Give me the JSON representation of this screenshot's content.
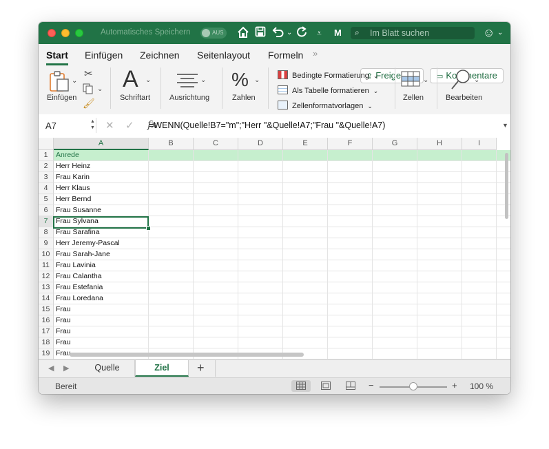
{
  "titlebar": {
    "autosave_label": "Automatisches Speichern",
    "autosave_toggle": "AUS",
    "search_placeholder": "Im Blatt suchen",
    "profile_initial": "M"
  },
  "ribbon": {
    "tabs": [
      "Start",
      "Einfügen",
      "Zeichnen",
      "Seitenlayout",
      "Formeln"
    ],
    "share_label": "Freigeben",
    "comments_label": "Kommentare",
    "groups": {
      "paste": "Einfügen",
      "font": "Schriftart",
      "alignment": "Ausrichtung",
      "number": "Zahlen",
      "cells": "Zellen",
      "edit": "Bearbeiten"
    },
    "styles": {
      "conditional": "Bedingte Formatierung",
      "as_table": "Als Tabelle formatieren",
      "cell_styles": "Zellenformatvorlagen"
    }
  },
  "formula_bar": {
    "name_box": "A7",
    "fx": "fx",
    "formula": "=WENN(Quelle!B7=\"m\";\"Herr \"&Quelle!A7;\"Frau \"&Quelle!A7)"
  },
  "sheet": {
    "columns": [
      "A",
      "B",
      "C",
      "D",
      "E",
      "F",
      "G",
      "H",
      "I"
    ],
    "selected_cell": "A7",
    "rows": [
      {
        "n": "1",
        "a": "Anrede"
      },
      {
        "n": "2",
        "a": "Herr Heinz"
      },
      {
        "n": "3",
        "a": "Frau Karin"
      },
      {
        "n": "4",
        "a": "Herr Klaus"
      },
      {
        "n": "5",
        "a": "Herr Bernd"
      },
      {
        "n": "6",
        "a": "Frau Susanne"
      },
      {
        "n": "7",
        "a": "Frau Sylvana"
      },
      {
        "n": "8",
        "a": "Frau Sarafina"
      },
      {
        "n": "9",
        "a": "Herr Jeremy-Pascal"
      },
      {
        "n": "10",
        "a": "Frau Sarah-Jane"
      },
      {
        "n": "11",
        "a": "Frau Lavinia"
      },
      {
        "n": "12",
        "a": "Frau Calantha"
      },
      {
        "n": "13",
        "a": "Frau Estefania"
      },
      {
        "n": "14",
        "a": "Frau Loredana"
      },
      {
        "n": "15",
        "a": "Frau"
      },
      {
        "n": "16",
        "a": "Frau"
      },
      {
        "n": "17",
        "a": "Frau"
      },
      {
        "n": "18",
        "a": "Frau"
      },
      {
        "n": "19",
        "a": "Frau"
      }
    ]
  },
  "sheet_tabs": {
    "tabs": [
      "Quelle",
      "Ziel"
    ],
    "active": "Ziel",
    "add_label": "+"
  },
  "status_bar": {
    "status": "Bereit",
    "zoom_minus": "−",
    "zoom_plus": "+",
    "zoom": "100 %"
  },
  "colors": {
    "accent": "#217346",
    "header_fill": "#c6efce"
  }
}
